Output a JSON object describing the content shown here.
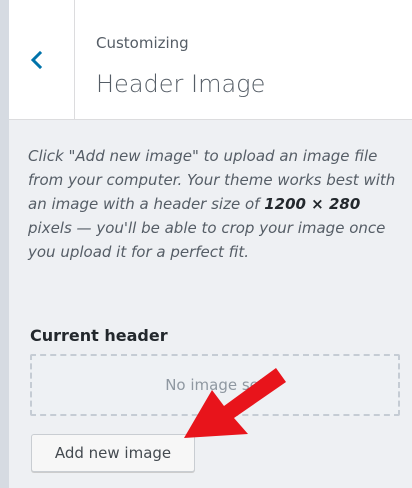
{
  "header": {
    "breadcrumb": "Customizing",
    "title": "Header Image",
    "back_icon": "chevron-left-icon"
  },
  "description": {
    "part1": "Click \"Add new image\" to upload an image file from your computer. Your theme works best with an image with a header size of ",
    "size": "1200 × 280",
    "part2": " pixels — you'll be able to crop your image once you upload it for a perfect fit."
  },
  "current_header": {
    "label": "Current header",
    "placeholder": "No image set"
  },
  "actions": {
    "add_new_image": "Add new image"
  },
  "colors": {
    "accent": "#0073aa",
    "annotation_arrow": "#e8141b"
  }
}
